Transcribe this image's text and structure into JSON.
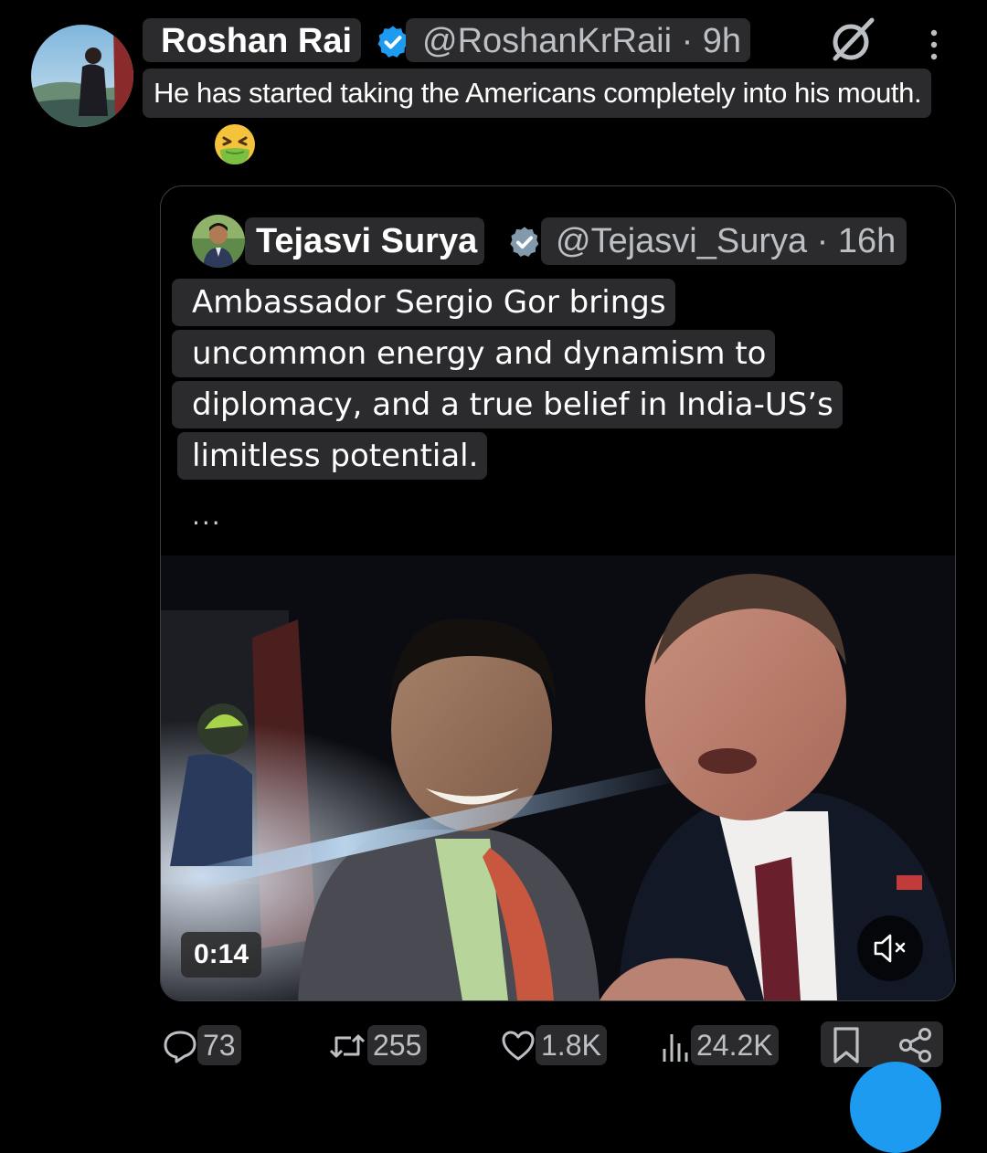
{
  "post": {
    "author_name": "Roshan Rai",
    "handle_time": "@RoshanKrRaii · 9h",
    "text": "He has started taking the Americans completely into his mouth.",
    "emoji": "nauseated-face"
  },
  "quoted": {
    "author_name": "Tejasvi Surya",
    "handle_time": "@Tejasvi_Surya · 16h",
    "lines": [
      "Ambassador Sergio Gor brings",
      "uncommon energy and dynamism to",
      "diplomacy, and a true belief in India-US’s",
      "limitless potential."
    ],
    "ellipsis": "...",
    "video_duration": "0:14"
  },
  "actions": {
    "replies": "73",
    "reposts": "255",
    "likes": "1.8K",
    "views": "24.2K"
  },
  "colors": {
    "verified": "#1d9bf0",
    "verified_gray": "#829aab",
    "accent": "#1d9bf0"
  }
}
